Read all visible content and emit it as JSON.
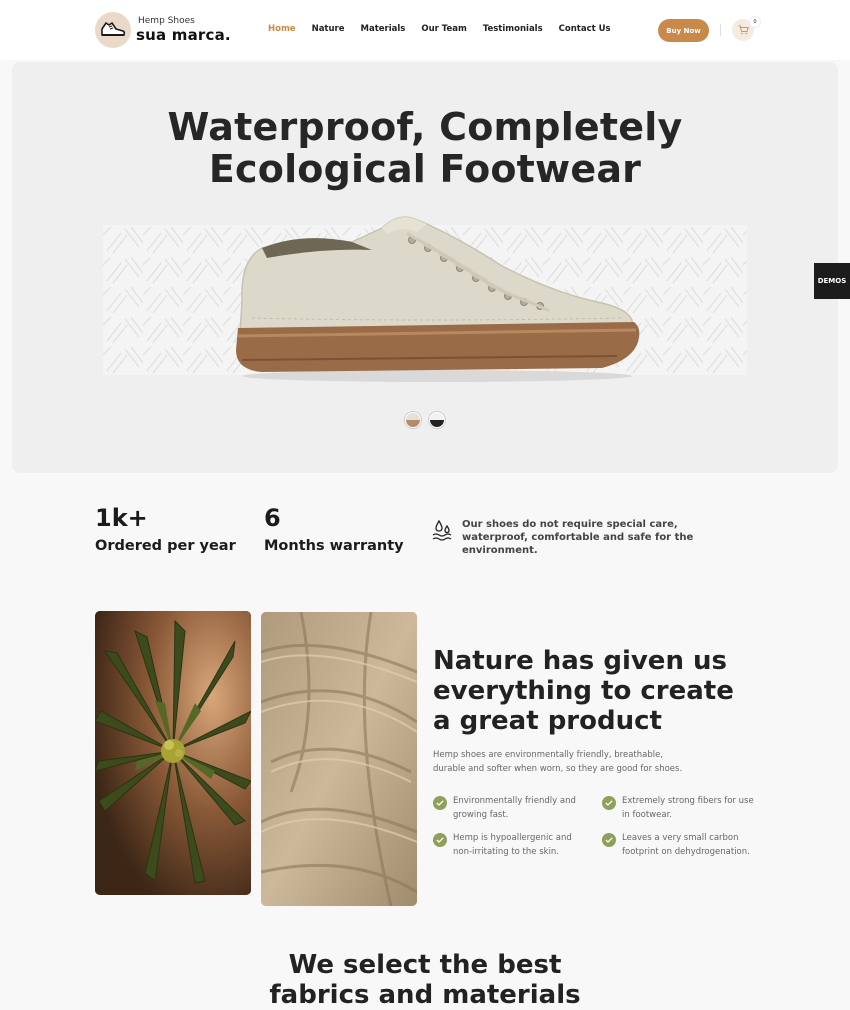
{
  "header": {
    "brand_top": "Hemp Shoes",
    "brand_bottom": "sua marca.",
    "nav": [
      "Home",
      "Nature",
      "Materials",
      "Our Team",
      "Testimonials",
      "Contact Us"
    ],
    "active_nav": "Home",
    "buy_label": "Buy Now",
    "cart_count": "0",
    "icons": {
      "logo": "sneaker-icon",
      "cart": "shopping-cart-icon"
    }
  },
  "hero": {
    "title_line1": "Waterproof, Completely",
    "title_line2": "Ecological Footwear",
    "swatches": [
      {
        "name": "tan",
        "colors": [
          "#e5e0d8",
          "#b68a66"
        ]
      },
      {
        "name": "dark",
        "colors": [
          "#f2f2f2",
          "#222222"
        ]
      }
    ]
  },
  "demos_label": "DEMOS",
  "stats": [
    {
      "value": "1k+",
      "label": "Ordered per year"
    },
    {
      "value": "6",
      "label": "Months warranty"
    }
  ],
  "care_text": "Our shoes do not require special care, waterproof, comfortable and safe for the environment.",
  "nature": {
    "title_line1": "Nature has given us",
    "title_line2": "everything to create",
    "title_line3": "a great product",
    "description": "Hemp shoes are environmentally friendly, breathable, durable and softer when worn, so they are good for shoes.",
    "features": [
      "Environmentally friendly and growing fast.",
      "Extremely strong fibers for use in footwear.",
      "Hemp is hypoallergenic and non-irritating to the skin.",
      "Leaves a very small carbon footprint on dehydrogenation."
    ]
  },
  "select": {
    "title_line1": "We select the best",
    "title_line2": "fabrics and materials"
  },
  "colors": {
    "accent": "#c8894b",
    "check": "#8ea05a",
    "hero_bg": "#efefef",
    "page_bg": "#f8f8f9"
  }
}
